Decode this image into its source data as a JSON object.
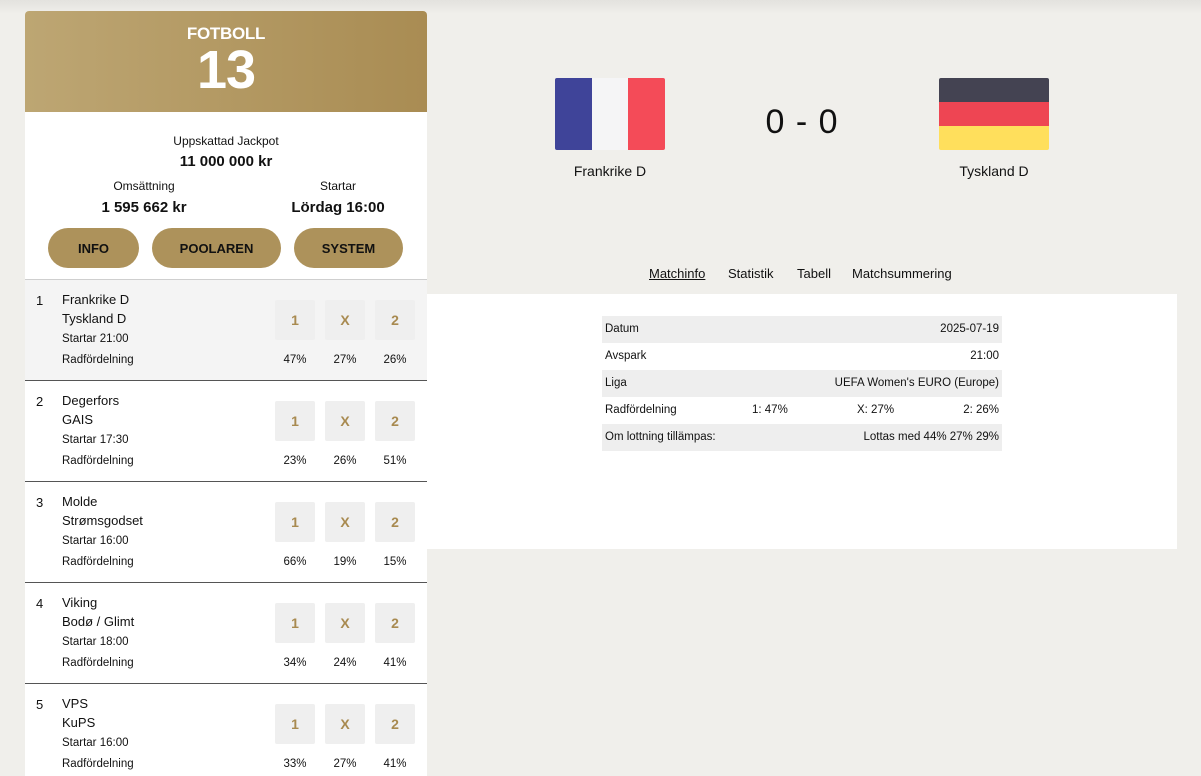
{
  "coupon": {
    "game_name": "FOTBOLL",
    "game_number": "13",
    "jackpot_label": "Uppskattad Jackpot",
    "jackpot_value": "11 000 000 kr",
    "omsattning_label": "Omsättning",
    "omsattning_value": "1 595 662 kr",
    "startar_label": "Startar",
    "startar_value": "Lördag 16:00",
    "buttons": {
      "info": "INFO",
      "poolaren": "POOLAREN",
      "system": "SYSTEM"
    },
    "dist_label": "Radfördelning",
    "signs": [
      "1",
      "X",
      "2"
    ],
    "matches": [
      {
        "num": "1",
        "home": "Frankrike D",
        "away": "Tyskland D",
        "start": "Startar 21:00",
        "p1": "47%",
        "px": "27%",
        "p2": "26%"
      },
      {
        "num": "2",
        "home": "Degerfors",
        "away": "GAIS",
        "start": "Startar 17:30",
        "p1": "23%",
        "px": "26%",
        "p2": "51%"
      },
      {
        "num": "3",
        "home": "Molde",
        "away": "Strømsgodset",
        "start": "Startar 16:00",
        "p1": "66%",
        "px": "19%",
        "p2": "15%"
      },
      {
        "num": "4",
        "home": "Viking",
        "away": "Bodø / Glimt",
        "start": "Startar 18:00",
        "p1": "34%",
        "px": "24%",
        "p2": "41%"
      },
      {
        "num": "5",
        "home": "VPS",
        "away": "KuPS",
        "start": "Startar 16:00",
        "p1": "33%",
        "px": "27%",
        "p2": "41%"
      }
    ]
  },
  "detail": {
    "home_team": "Frankrike D",
    "away_team": "Tyskland D",
    "score": "0 - 0",
    "home_flag_colors": [
      "#3f4499",
      "#f5f5f6",
      "#f44b58"
    ],
    "away_flag_colors": [
      "#444352",
      "#ee4553",
      "#ffdf5c"
    ],
    "tabs": [
      "Matchinfo",
      "Statistik",
      "Tabell",
      "Matchsummering"
    ],
    "info": {
      "datum_label": "Datum",
      "datum_value": "2025-07-19",
      "avspark_label": "Avspark",
      "avspark_value": "21:00",
      "liga_label": "Liga",
      "liga_value": "UEFA Women's EURO (Europe)",
      "dist_label": "Radfördelning",
      "dist_1": "1: 47%",
      "dist_x": "X: 27%",
      "dist_2": "2: 26%",
      "lottning_label": "Om lottning tillämpas:",
      "lottning_value": "Lottas med 44% 27% 29%"
    }
  }
}
